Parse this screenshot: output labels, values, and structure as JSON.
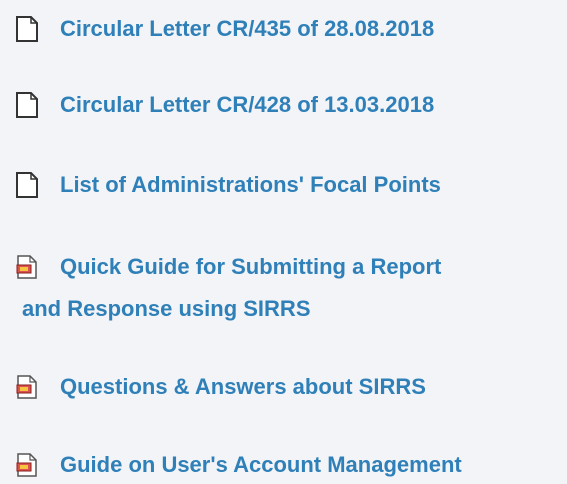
{
  "links": [
    {
      "label": "Circular Letter CR/435 of 28.08.2018",
      "icon": "document-icon"
    },
    {
      "label": "Circular Letter CR/428 of 13.03.2018",
      "icon": "document-icon"
    },
    {
      "label": "List of Administrations' Focal Points",
      "icon": "document-icon"
    },
    {
      "label": "Quick Guide for Submitting a Report",
      "label_cont": "and Response using SIRRS",
      "icon": "pdf-document-icon"
    },
    {
      "label": "Questions & Answers about SIRRS",
      "icon": "pdf-document-icon"
    },
    {
      "label": "Guide on User's Account Management",
      "icon": "pdf-document-icon"
    }
  ],
  "colors": {
    "link": "#2f80b8",
    "background": "#f2f4f7"
  }
}
